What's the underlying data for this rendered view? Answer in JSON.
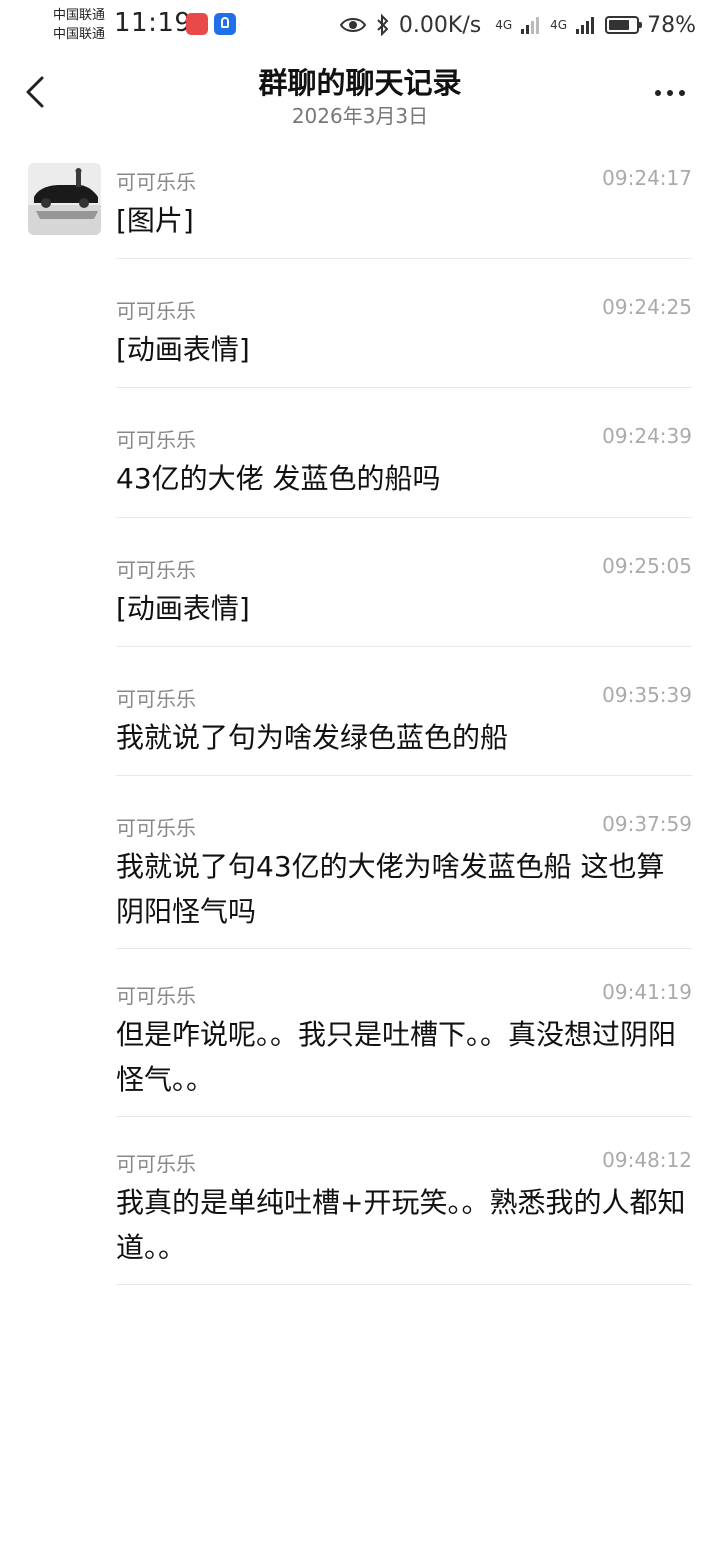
{
  "status_bar": {
    "carrier1": "中国联通",
    "carrier2": "中国联通",
    "time": "11:19",
    "net_speed": "0.00K/s",
    "signal1_label": "4G",
    "signal2_label": "4G",
    "battery": "78%",
    "battery_level": 0.78,
    "icons": [
      "huawei-appgallery-icon",
      "tips-icon",
      "eye-icon",
      "bluetooth-icon",
      "signal-icon",
      "battery-icon"
    ]
  },
  "header": {
    "title": "群聊的聊天记录",
    "subtitle": "2026年3月3日",
    "back_icon": "chevron-left-icon",
    "more_icon": "more-icon"
  },
  "messages": [
    {
      "sender": "可可乐乐",
      "time": "09:24:17",
      "content": "[图片]"
    },
    {
      "sender": "可可乐乐",
      "time": "09:24:25",
      "content": "[动画表情]"
    },
    {
      "sender": "可可乐乐",
      "time": "09:24:39",
      "content": "43亿的大佬  发蓝色的船吗"
    },
    {
      "sender": "可可乐乐",
      "time": "09:25:05",
      "content": "[动画表情]"
    },
    {
      "sender": "可可乐乐",
      "time": "09:35:39",
      "content": "我就说了句为啥发绿色蓝色的船"
    },
    {
      "sender": "可可乐乐",
      "time": "09:37:59",
      "content": "我就说了句43亿的大佬为啥发蓝色船  这也算阴阳怪气吗"
    },
    {
      "sender": "可可乐乐",
      "time": "09:41:19",
      "content": "但是咋说呢。。我只是吐槽下。。真没想过阴阳怪气。。"
    },
    {
      "sender": "可可乐乐",
      "time": "09:48:12",
      "content": "我真的是单纯吐槽+开玩笑。。熟悉我的人都知道。。"
    }
  ]
}
